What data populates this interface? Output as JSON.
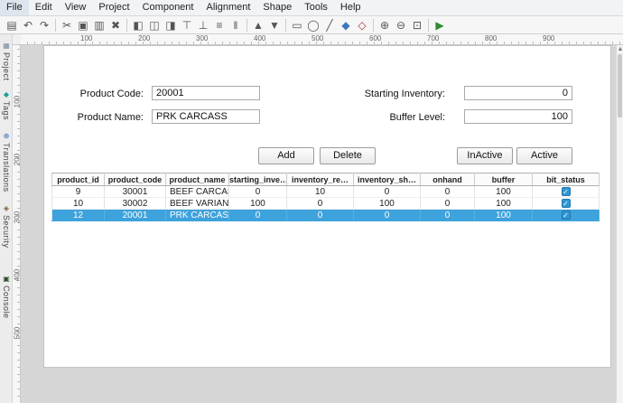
{
  "menu": {
    "items": [
      "File",
      "Edit",
      "View",
      "Project",
      "Component",
      "Alignment",
      "Shape",
      "Tools",
      "Help"
    ]
  },
  "toolbar": {
    "icons": [
      {
        "name": "save",
        "glyph": "▤"
      },
      {
        "name": "undo",
        "glyph": "↶"
      },
      {
        "name": "redo",
        "glyph": "↷"
      },
      {
        "name": "cut",
        "glyph": "✂"
      },
      {
        "name": "copy",
        "glyph": "▣"
      },
      {
        "name": "paste",
        "glyph": "▥"
      },
      {
        "name": "delete",
        "glyph": "✖"
      },
      {
        "name": "align-left",
        "glyph": "◧"
      },
      {
        "name": "align-center-horizontal",
        "glyph": "◫"
      },
      {
        "name": "align-right",
        "glyph": "◨"
      },
      {
        "name": "align-top",
        "glyph": "⊤"
      },
      {
        "name": "align-bottom",
        "glyph": "⊥"
      },
      {
        "name": "distribute-horizontal",
        "glyph": "≡"
      },
      {
        "name": "distribute-vertical",
        "glyph": "‖"
      },
      {
        "name": "bring-forward",
        "glyph": "▲"
      },
      {
        "name": "send-backward",
        "glyph": "▼"
      },
      {
        "name": "rectangle-tool",
        "glyph": "▭"
      },
      {
        "name": "ellipse-tool",
        "glyph": "◯"
      },
      {
        "name": "line-tool",
        "glyph": "╱"
      },
      {
        "name": "fill-color",
        "glyph": "◆"
      },
      {
        "name": "stroke-color",
        "glyph": "◇"
      },
      {
        "name": "zoom-in",
        "glyph": "⊕"
      },
      {
        "name": "zoom-out",
        "glyph": "⊖"
      },
      {
        "name": "zoom-reset",
        "glyph": "⊡"
      },
      {
        "name": "preview-play",
        "glyph": "▶"
      }
    ]
  },
  "sidebar": {
    "tabs": [
      {
        "label": "Project",
        "glyph": "▦"
      },
      {
        "label": "Tags",
        "glyph": "◆"
      },
      {
        "label": "Translations",
        "glyph": "⊕"
      },
      {
        "label": "Security",
        "glyph": "◈"
      },
      {
        "label": "Console",
        "glyph": "▣"
      }
    ]
  },
  "rulers": {
    "top": [
      "100",
      "200",
      "300",
      "400",
      "500",
      "600",
      "700",
      "800",
      "900"
    ],
    "left": [
      "100",
      "200",
      "300",
      "400",
      "500"
    ]
  },
  "scrollbar": {
    "up_arrow": "▲"
  },
  "form": {
    "product_code_label": "Product Code:",
    "product_code_value": "20001",
    "product_name_label": "Product Name:",
    "product_name_value": "PRK CARCASS",
    "starting_inventory_label": "Starting Inventory:",
    "starting_inventory_value": "0",
    "buffer_level_label": "Buffer Level:",
    "buffer_level_value": "100",
    "buttons": {
      "add": "Add",
      "delete": "Delete",
      "inactive": "InActive",
      "active": "Active"
    }
  },
  "table": {
    "columns": [
      "product_id",
      "product_code",
      "product_name",
      "starting_inve…",
      "inventory_re…",
      "inventory_sh…",
      "onhand",
      "buffer",
      "bit_status"
    ],
    "rows": [
      {
        "cells": [
          "9",
          "30001",
          "BEEF CARCASS",
          "0",
          "10",
          "0",
          "0",
          "100"
        ],
        "bit_status": true,
        "selected": false
      },
      {
        "cells": [
          "10",
          "30002",
          "BEEF VARIANCE",
          "100",
          "0",
          "100",
          "0",
          "100"
        ],
        "bit_status": true,
        "selected": false
      },
      {
        "cells": [
          "12",
          "20001",
          "PRK CARCASS",
          "0",
          "0",
          "0",
          "0",
          "100"
        ],
        "bit_status": true,
        "selected": true
      }
    ]
  }
}
